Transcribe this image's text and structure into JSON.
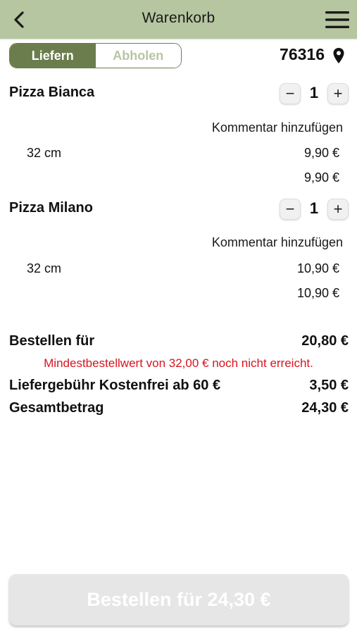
{
  "header": {
    "title": "Warenkorb",
    "back_icon": "chevron-left-icon",
    "menu_icon": "hamburger-menu-icon",
    "background": "#b6c6a0"
  },
  "delivery_mode": {
    "options": [
      "Liefern",
      "Abholen"
    ],
    "selected": "Liefern",
    "accent": "#6b7d4c"
  },
  "location": {
    "zip": "76316",
    "icon": "map-pin-icon"
  },
  "items": [
    {
      "name": "Pizza Bianca",
      "quantity": "1",
      "minus": "−",
      "plus": "+",
      "comment_link": "Kommentar hinzufügen",
      "size": "32 cm",
      "size_price": "9,90 €",
      "line_total": "9,90 €"
    },
    {
      "name": "Pizza Milano",
      "quantity": "1",
      "minus": "−",
      "plus": "+",
      "comment_link": "Kommentar hinzufügen",
      "size": "32 cm",
      "size_price": "10,90 €",
      "line_total": "10,90 €"
    }
  ],
  "summary": {
    "order_for_label": "Bestellen für",
    "order_for_value": "20,80 €",
    "minimum_warning": "Mindestbestellwert von 32,00 € noch nicht erreicht.",
    "delivery_fee_label": "Liefergebühr Kostenfrei ab 60 €",
    "delivery_fee_value": "3,50 €",
    "total_label": "Gesamtbetrag",
    "total_value": "24,30 €",
    "warning_color": "#d9141e"
  },
  "order_button": {
    "label": "Bestellen für 24,30 €",
    "enabled": false
  }
}
